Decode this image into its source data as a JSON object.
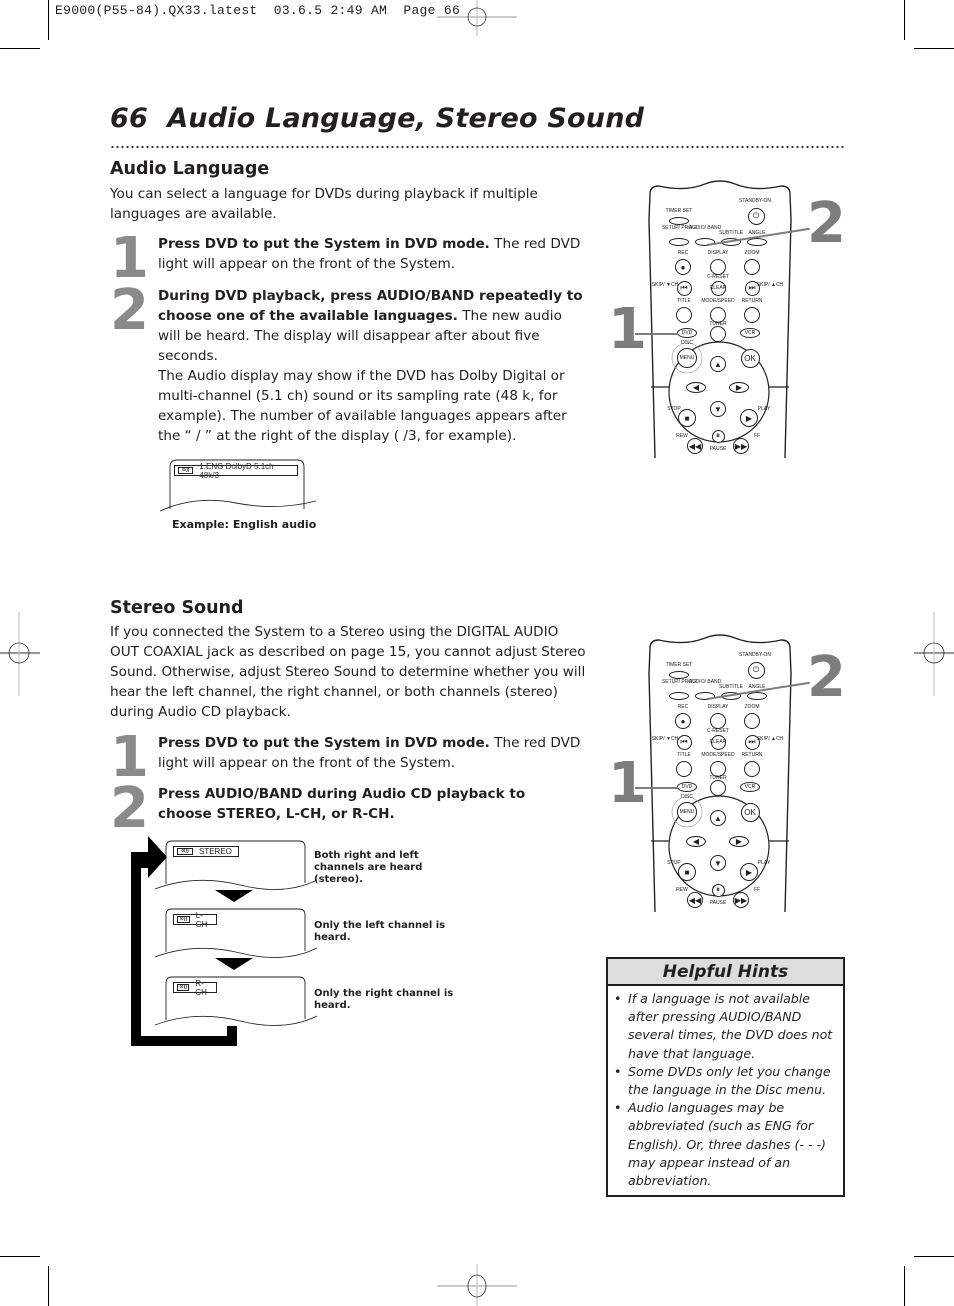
{
  "slug": {
    "text": "E9000(P55-84).QX33.latest  03.6.5 2:49 AM  Page 66"
  },
  "header": {
    "page_number": "66",
    "title": "Audio Language, Stereo Sound"
  },
  "audio_language": {
    "heading": "Audio Language",
    "intro": "You can select a language for DVDs during playback if multiple languages are available.",
    "steps": [
      {
        "number": "1",
        "bold": "Press DVD to put the System in DVD mode.",
        "text": " The red DVD light will appear on the front of the System."
      },
      {
        "number": "2",
        "bold": "During DVD playback, press AUDIO/BAND repeatedly to choose one of the available languages.",
        "text": " The new audio will be heard. The display will disappear after about five seconds.",
        "extra": "The Audio display may show if the DVD has Dolby Digital or multi-channel (5.1 ch) sound or its sampling rate (48 k, for example). The number of available languages appears after the “ / ” at the right of the display ( /3, for example)."
      }
    ],
    "osd": {
      "icon": "audio-icon",
      "text": "1.ENG DolbyD 5.1ch 48k/3",
      "caption": "Example: English audio"
    }
  },
  "stereo_sound": {
    "heading": "Stereo Sound",
    "intro": "If you connected the System to a Stereo using the DIGITAL AUDIO OUT COAXIAL jack as described on page 15, you cannot adjust Stereo Sound. Otherwise, adjust Stereo Sound to determine whether you will hear the left channel, the right channel, or both channels (stereo) during Audio CD playback.",
    "steps": [
      {
        "number": "1",
        "bold": "Press DVD to put the System in DVD mode.",
        "text": " The red DVD light will appear on the front of the System."
      },
      {
        "number": "2",
        "bold": "Press AUDIO/BAND during Audio CD playback to choose STEREO, L-CH, or R-CH.",
        "text": ""
      }
    ],
    "modes": [
      {
        "label": "STEREO",
        "caption": "Both right and left channels are heard (stereo)."
      },
      {
        "label": "L-CH",
        "caption": "Only the left channel is heard."
      },
      {
        "label": "R-CH",
        "caption": "Only the right channel is heard."
      }
    ]
  },
  "remote": {
    "callouts": [
      "1",
      "2"
    ],
    "labels": {
      "standby": "STANDBY-ON",
      "timer_set": "TIMER SET",
      "setup_prog": "SETUP/ PROG",
      "audio_band": "AUDIO/ BAND",
      "subtitle": "SUBTITLE",
      "angle": "ANGLE",
      "rec": "REC",
      "display": "DISPLAY",
      "zoom": "ZOOM",
      "c_reset": "C-RESET",
      "skip_down": "SKIP/ ▼CH",
      "clear": "CLEAR",
      "skip_up": "SKIP/ ▲CH",
      "title": "TITLE",
      "mode_speed": "MODE/SPEED",
      "return": "RETURN",
      "tuner": "TUNER",
      "dvd": "DVD",
      "vcr": "VCR",
      "disc": "DISC",
      "menu": "MENU",
      "ok": "OK",
      "stop": "STOP",
      "play": "PLAY",
      "rew": "REW",
      "ff": "FF",
      "pause": "PAUSE"
    }
  },
  "hints": {
    "title": "Helpful Hints",
    "items": [
      "If a language is not available after pressing AUDIO/BAND several times, the DVD does not have that language.",
      "Some DVDs only let you change the language in the Disc menu.",
      "Audio languages may be abbreviated (such as ENG for English). Or, three dashes (- - -) may appear instead of an abbreviation."
    ]
  }
}
